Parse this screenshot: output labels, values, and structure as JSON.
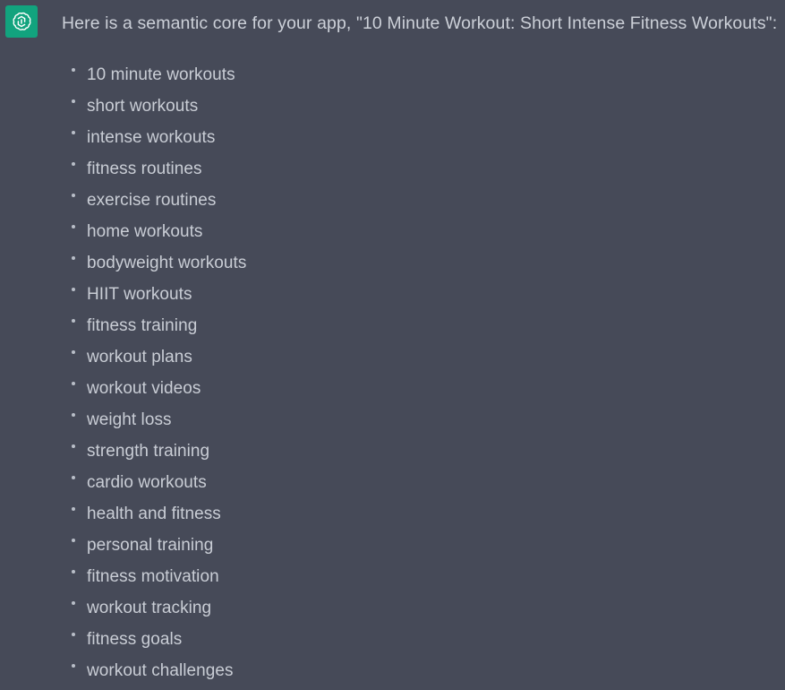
{
  "theme": {
    "background_color": "#464a58",
    "text_color": "#c9cdd5",
    "avatar_background_color": "#12a37e",
    "bullet_color": "#b9bec8"
  },
  "message": {
    "avatar_icon": "openai-logo-icon",
    "title": "Here is a semantic core for your app, \"10 Minute Workout: Short Intense Fitness Workouts\":"
  },
  "keywords": [
    {
      "label": "10 minute workouts"
    },
    {
      "label": "short workouts"
    },
    {
      "label": "intense workouts"
    },
    {
      "label": "fitness routines"
    },
    {
      "label": "exercise routines"
    },
    {
      "label": "home workouts"
    },
    {
      "label": "bodyweight workouts"
    },
    {
      "label": "HIIT workouts"
    },
    {
      "label": "fitness training"
    },
    {
      "label": "workout plans"
    },
    {
      "label": "workout videos"
    },
    {
      "label": "weight loss"
    },
    {
      "label": "strength training"
    },
    {
      "label": "cardio workouts"
    },
    {
      "label": "health and fitness"
    },
    {
      "label": "personal training"
    },
    {
      "label": "fitness motivation"
    },
    {
      "label": "workout tracking"
    },
    {
      "label": "fitness goals"
    },
    {
      "label": "workout challenges"
    }
  ]
}
